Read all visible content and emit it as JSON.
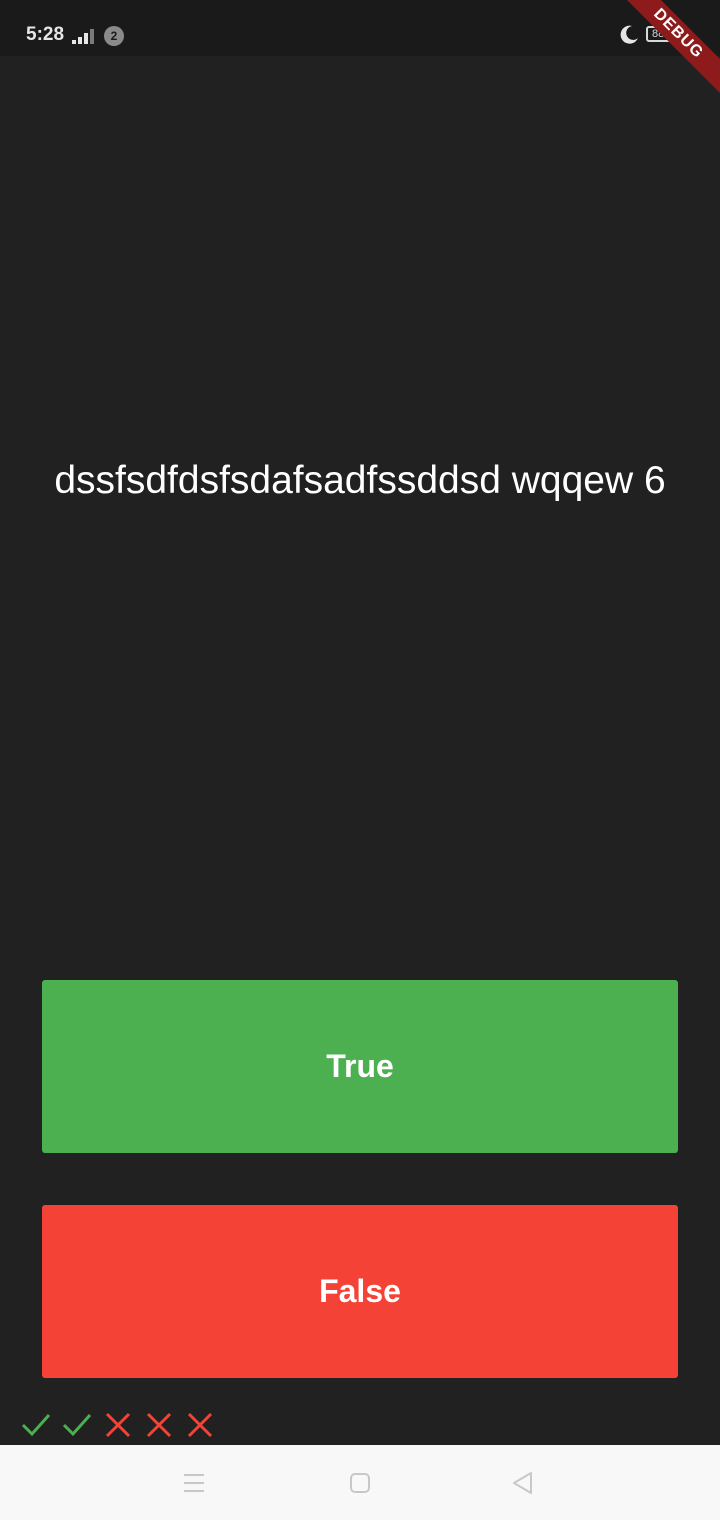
{
  "status_bar": {
    "time": "5:28",
    "notification_count": "2",
    "battery_level": "88",
    "icons": [
      "signal-icon",
      "moon-icon",
      "battery-icon"
    ]
  },
  "debug_banner": "DEBUG",
  "quiz": {
    "question": "dssfsdfdsfsdafsadfssddsd wqqew 6",
    "true_label": "True",
    "false_label": "False",
    "true_color": "#4caf50",
    "false_color": "#f44336"
  },
  "score_keeper": [
    "check",
    "check",
    "close",
    "close",
    "close"
  ],
  "navigation_bar": {
    "icons": [
      "menu-icon",
      "home-icon",
      "back-icon"
    ]
  },
  "colors": {
    "background": "#212121",
    "check": "#4caf50",
    "cross": "#f44336"
  }
}
